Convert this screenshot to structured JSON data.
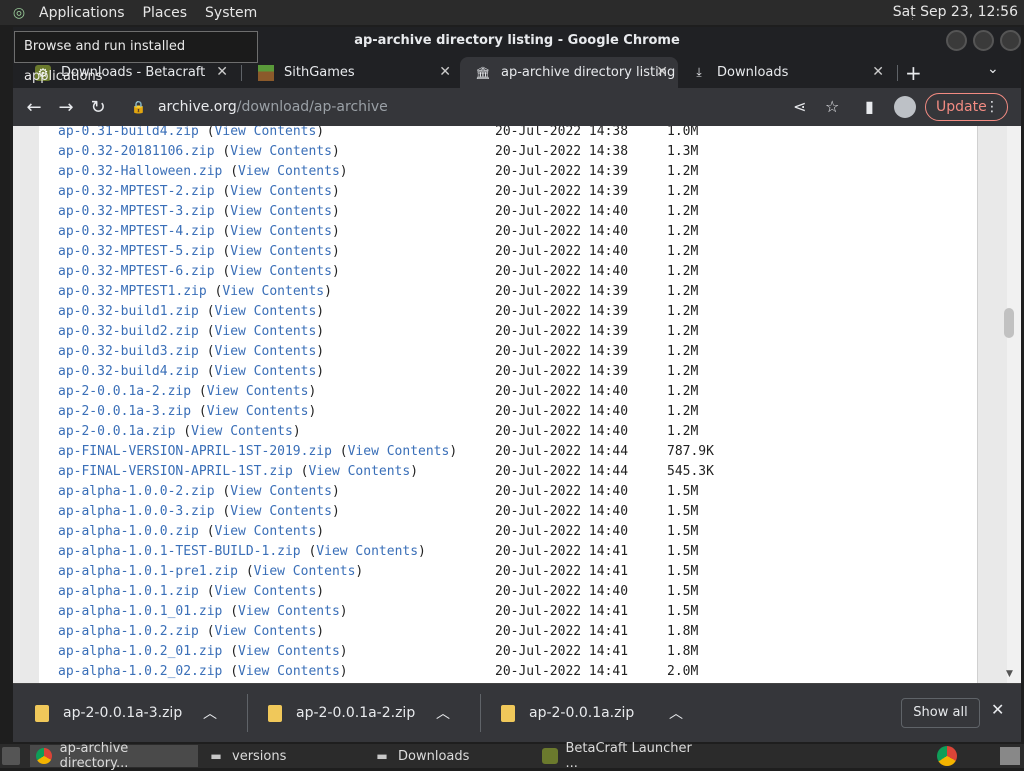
{
  "top_panel": {
    "menus": [
      "Applications",
      "Places",
      "System"
    ],
    "clock": "Sat Sep 23, 12:56"
  },
  "tooltip": "Browse and run installed applications",
  "window": {
    "title": "ap-archive directory listing - Google Chrome"
  },
  "tabs": [
    {
      "label": "Downloads - Betacraft",
      "icon": "betacraft-icon"
    },
    {
      "label": "SithGames",
      "icon": "minecraft-grass-icon"
    },
    {
      "label": "ap-archive directory listing",
      "icon": "archive-icon",
      "active": true
    },
    {
      "label": "Downloads",
      "icon": "download-icon"
    }
  ],
  "toolbar": {
    "url_host": "archive.org",
    "url_path": "/download/ap-archive",
    "update_label": "Update"
  },
  "listing": [
    {
      "name": "ap-0.31-build4.zip",
      "view": "View Contents",
      "date": "20-Jul-2022 14:38",
      "size": "1.0M"
    },
    {
      "name": "ap-0.32-20181106.zip",
      "view": "View Contents",
      "date": "20-Jul-2022 14:38",
      "size": "1.3M"
    },
    {
      "name": "ap-0.32-Halloween.zip",
      "view": "View Contents",
      "date": "20-Jul-2022 14:39",
      "size": "1.2M"
    },
    {
      "name": "ap-0.32-MPTEST-2.zip",
      "view": "View Contents",
      "date": "20-Jul-2022 14:39",
      "size": "1.2M"
    },
    {
      "name": "ap-0.32-MPTEST-3.zip",
      "view": "View Contents",
      "date": "20-Jul-2022 14:40",
      "size": "1.2M"
    },
    {
      "name": "ap-0.32-MPTEST-4.zip",
      "view": "View Contents",
      "date": "20-Jul-2022 14:40",
      "size": "1.2M"
    },
    {
      "name": "ap-0.32-MPTEST-5.zip",
      "view": "View Contents",
      "date": "20-Jul-2022 14:40",
      "size": "1.2M"
    },
    {
      "name": "ap-0.32-MPTEST-6.zip",
      "view": "View Contents",
      "date": "20-Jul-2022 14:40",
      "size": "1.2M"
    },
    {
      "name": "ap-0.32-MPTEST1.zip",
      "view": "View Contents",
      "date": "20-Jul-2022 14:39",
      "size": "1.2M"
    },
    {
      "name": "ap-0.32-build1.zip",
      "view": "View Contents",
      "date": "20-Jul-2022 14:39",
      "size": "1.2M"
    },
    {
      "name": "ap-0.32-build2.zip",
      "view": "View Contents",
      "date": "20-Jul-2022 14:39",
      "size": "1.2M"
    },
    {
      "name": "ap-0.32-build3.zip",
      "view": "View Contents",
      "date": "20-Jul-2022 14:39",
      "size": "1.2M"
    },
    {
      "name": "ap-0.32-build4.zip",
      "view": "View Contents",
      "date": "20-Jul-2022 14:39",
      "size": "1.2M"
    },
    {
      "name": "ap-2-0.0.1a-2.zip",
      "view": "View Contents",
      "date": "20-Jul-2022 14:40",
      "size": "1.2M"
    },
    {
      "name": "ap-2-0.0.1a-3.zip",
      "view": "View Contents",
      "date": "20-Jul-2022 14:40",
      "size": "1.2M"
    },
    {
      "name": "ap-2-0.0.1a.zip",
      "view": "View Contents",
      "date": "20-Jul-2022 14:40",
      "size": "1.2M"
    },
    {
      "name": "ap-FINAL-VERSION-APRIL-1ST-2019.zip",
      "view": "View Contents",
      "date": "20-Jul-2022 14:44",
      "size": "787.9K"
    },
    {
      "name": "ap-FINAL-VERSION-APRIL-1ST.zip",
      "view": "View Contents",
      "date": "20-Jul-2022 14:44",
      "size": "545.3K"
    },
    {
      "name": "ap-alpha-1.0.0-2.zip",
      "view": "View Contents",
      "date": "20-Jul-2022 14:40",
      "size": "1.5M"
    },
    {
      "name": "ap-alpha-1.0.0-3.zip",
      "view": "View Contents",
      "date": "20-Jul-2022 14:40",
      "size": "1.5M"
    },
    {
      "name": "ap-alpha-1.0.0.zip",
      "view": "View Contents",
      "date": "20-Jul-2022 14:40",
      "size": "1.5M"
    },
    {
      "name": "ap-alpha-1.0.1-TEST-BUILD-1.zip",
      "view": "View Contents",
      "date": "20-Jul-2022 14:41",
      "size": "1.5M"
    },
    {
      "name": "ap-alpha-1.0.1-pre1.zip",
      "view": "View Contents",
      "date": "20-Jul-2022 14:41",
      "size": "1.5M"
    },
    {
      "name": "ap-alpha-1.0.1.zip",
      "view": "View Contents",
      "date": "20-Jul-2022 14:40",
      "size": "1.5M"
    },
    {
      "name": "ap-alpha-1.0.1_01.zip",
      "view": "View Contents",
      "date": "20-Jul-2022 14:41",
      "size": "1.5M"
    },
    {
      "name": "ap-alpha-1.0.2.zip",
      "view": "View Contents",
      "date": "20-Jul-2022 14:41",
      "size": "1.8M"
    },
    {
      "name": "ap-alpha-1.0.2_01.zip",
      "view": "View Contents",
      "date": "20-Jul-2022 14:41",
      "size": "1.8M"
    },
    {
      "name": "ap-alpha-1.0.2_02.zip",
      "view": "View Contents",
      "date": "20-Jul-2022 14:41",
      "size": "2.0M"
    }
  ],
  "downloads": [
    "ap-2-0.0.1a-3.zip",
    "ap-2-0.0.1a-2.zip",
    "ap-2-0.0.1a.zip"
  ],
  "shelf": {
    "show_all": "Show all"
  },
  "taskbar": [
    {
      "label": "ap-archive directory...",
      "icon": "chrome-icon",
      "active": true
    },
    {
      "label": "versions",
      "icon": "folder-icon"
    },
    {
      "label": "Downloads",
      "icon": "folder-icon"
    },
    {
      "label": "BetaCraft Launcher ...",
      "icon": "betacraft-icon"
    }
  ],
  "colors": {
    "link": "#3a6fb8",
    "update_accent": "#f28b82",
    "file_icon": "#f0c85a"
  }
}
